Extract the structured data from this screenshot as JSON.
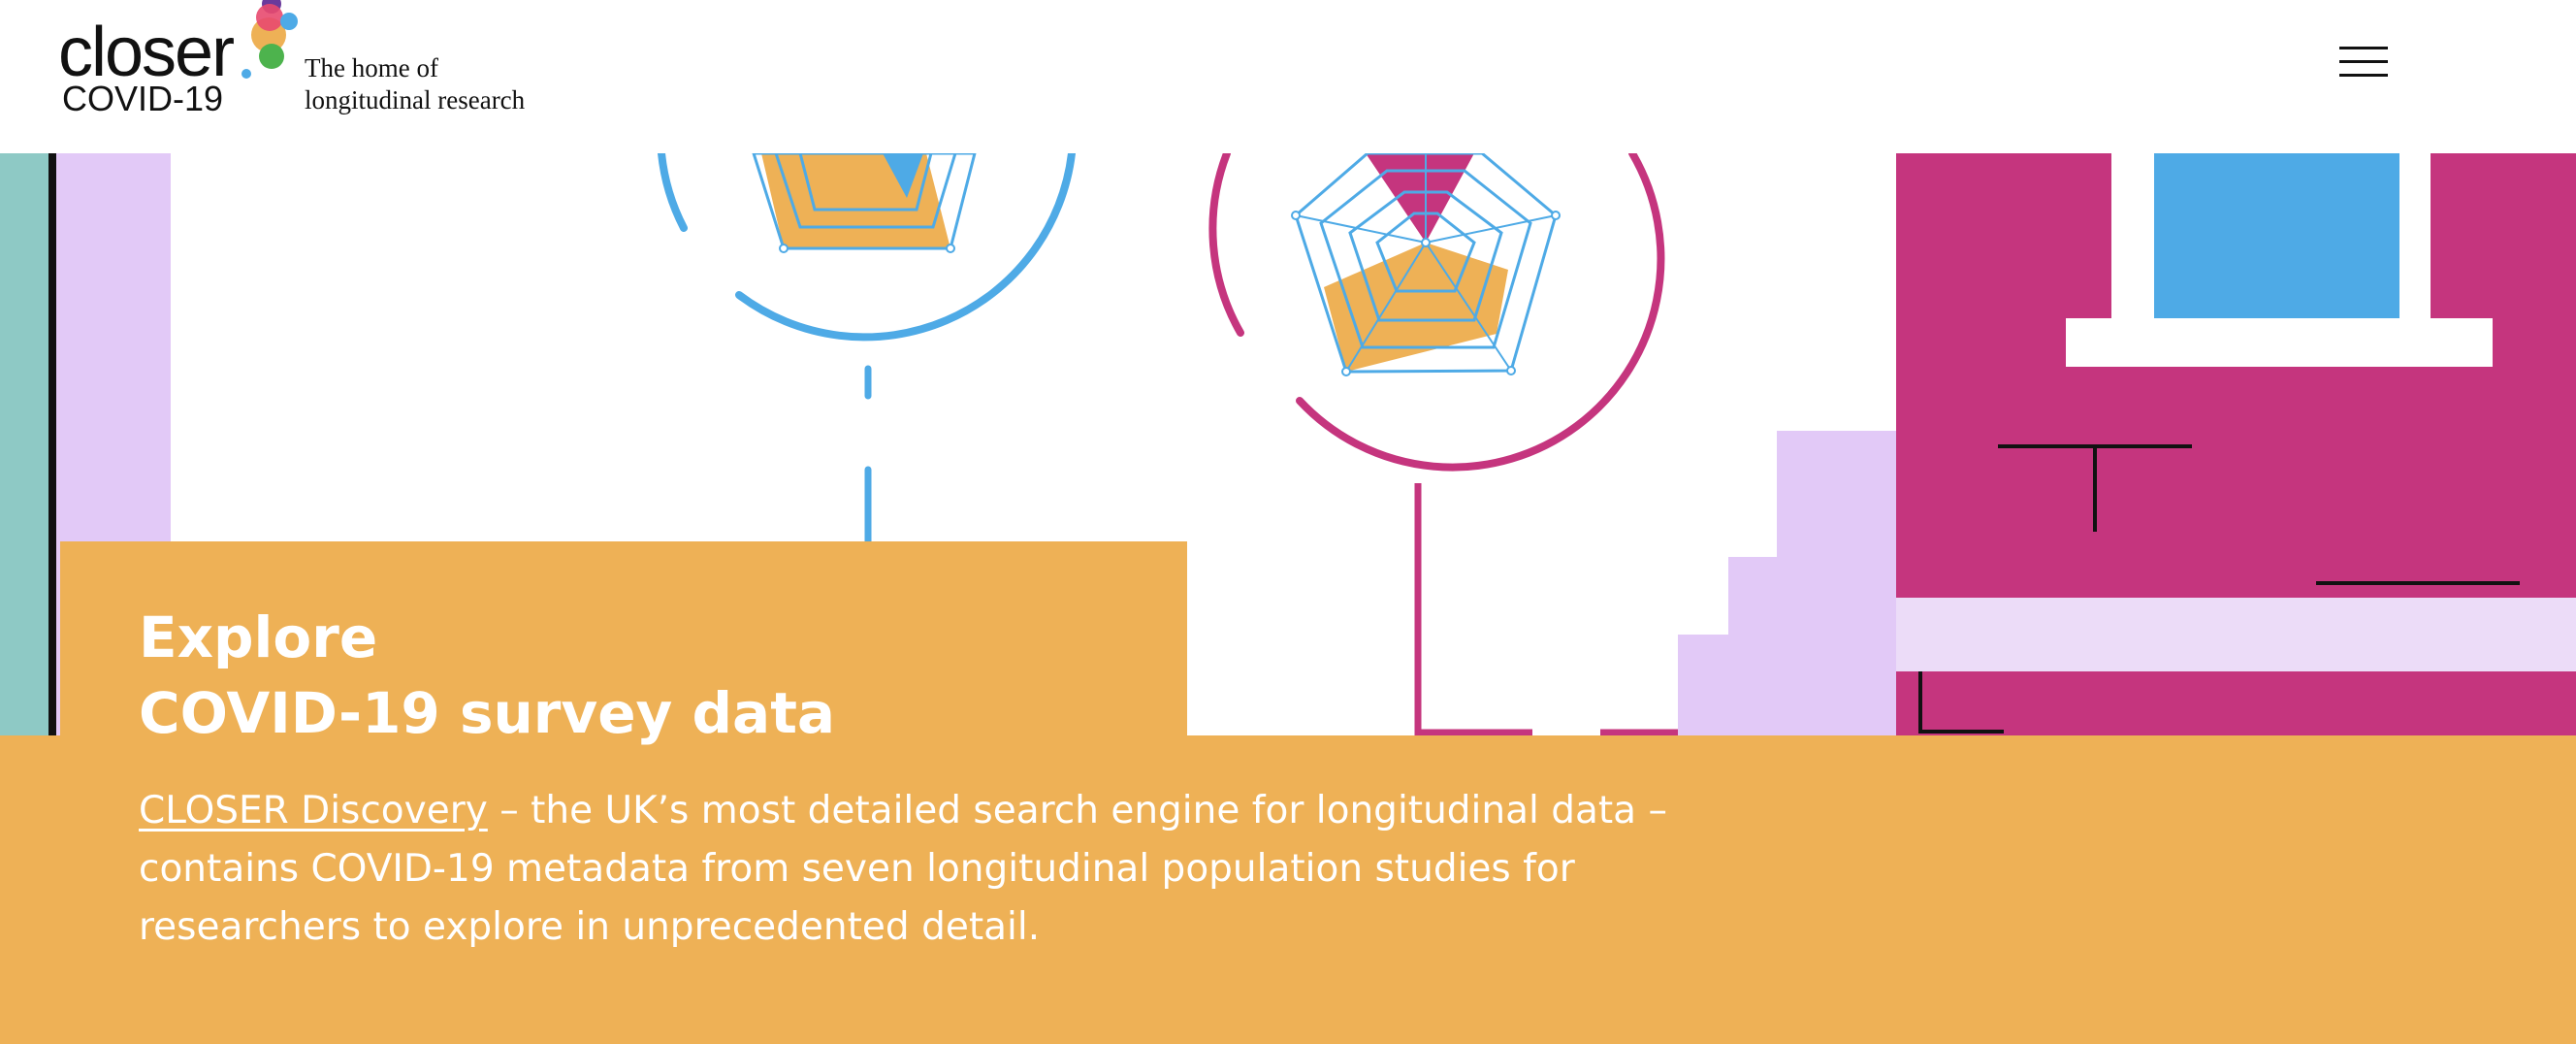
{
  "header": {
    "logo_word": "closer",
    "logo_sub": "COVID-19",
    "tagline_line1": "The home of",
    "tagline_line2": "longitudinal research",
    "menu_icon": "hamburger-menu-icon"
  },
  "colors": {
    "orange": "#eeb156",
    "magenta": "#c5357e",
    "blue": "#4eaae6",
    "lilac": "#e2c9f7",
    "teal": "#8ec9c5",
    "white": "#ffffff"
  },
  "hero": {
    "title_line1": "Explore",
    "title_line2": "COVID-19 survey data",
    "link_text": "CLOSER Discovery",
    "description": " – the UK’s most detailed search engine for longitudinal data – contains COVID-19 metadata from seven longitudinal population studies for researchers to explore in unprecedented detail."
  }
}
